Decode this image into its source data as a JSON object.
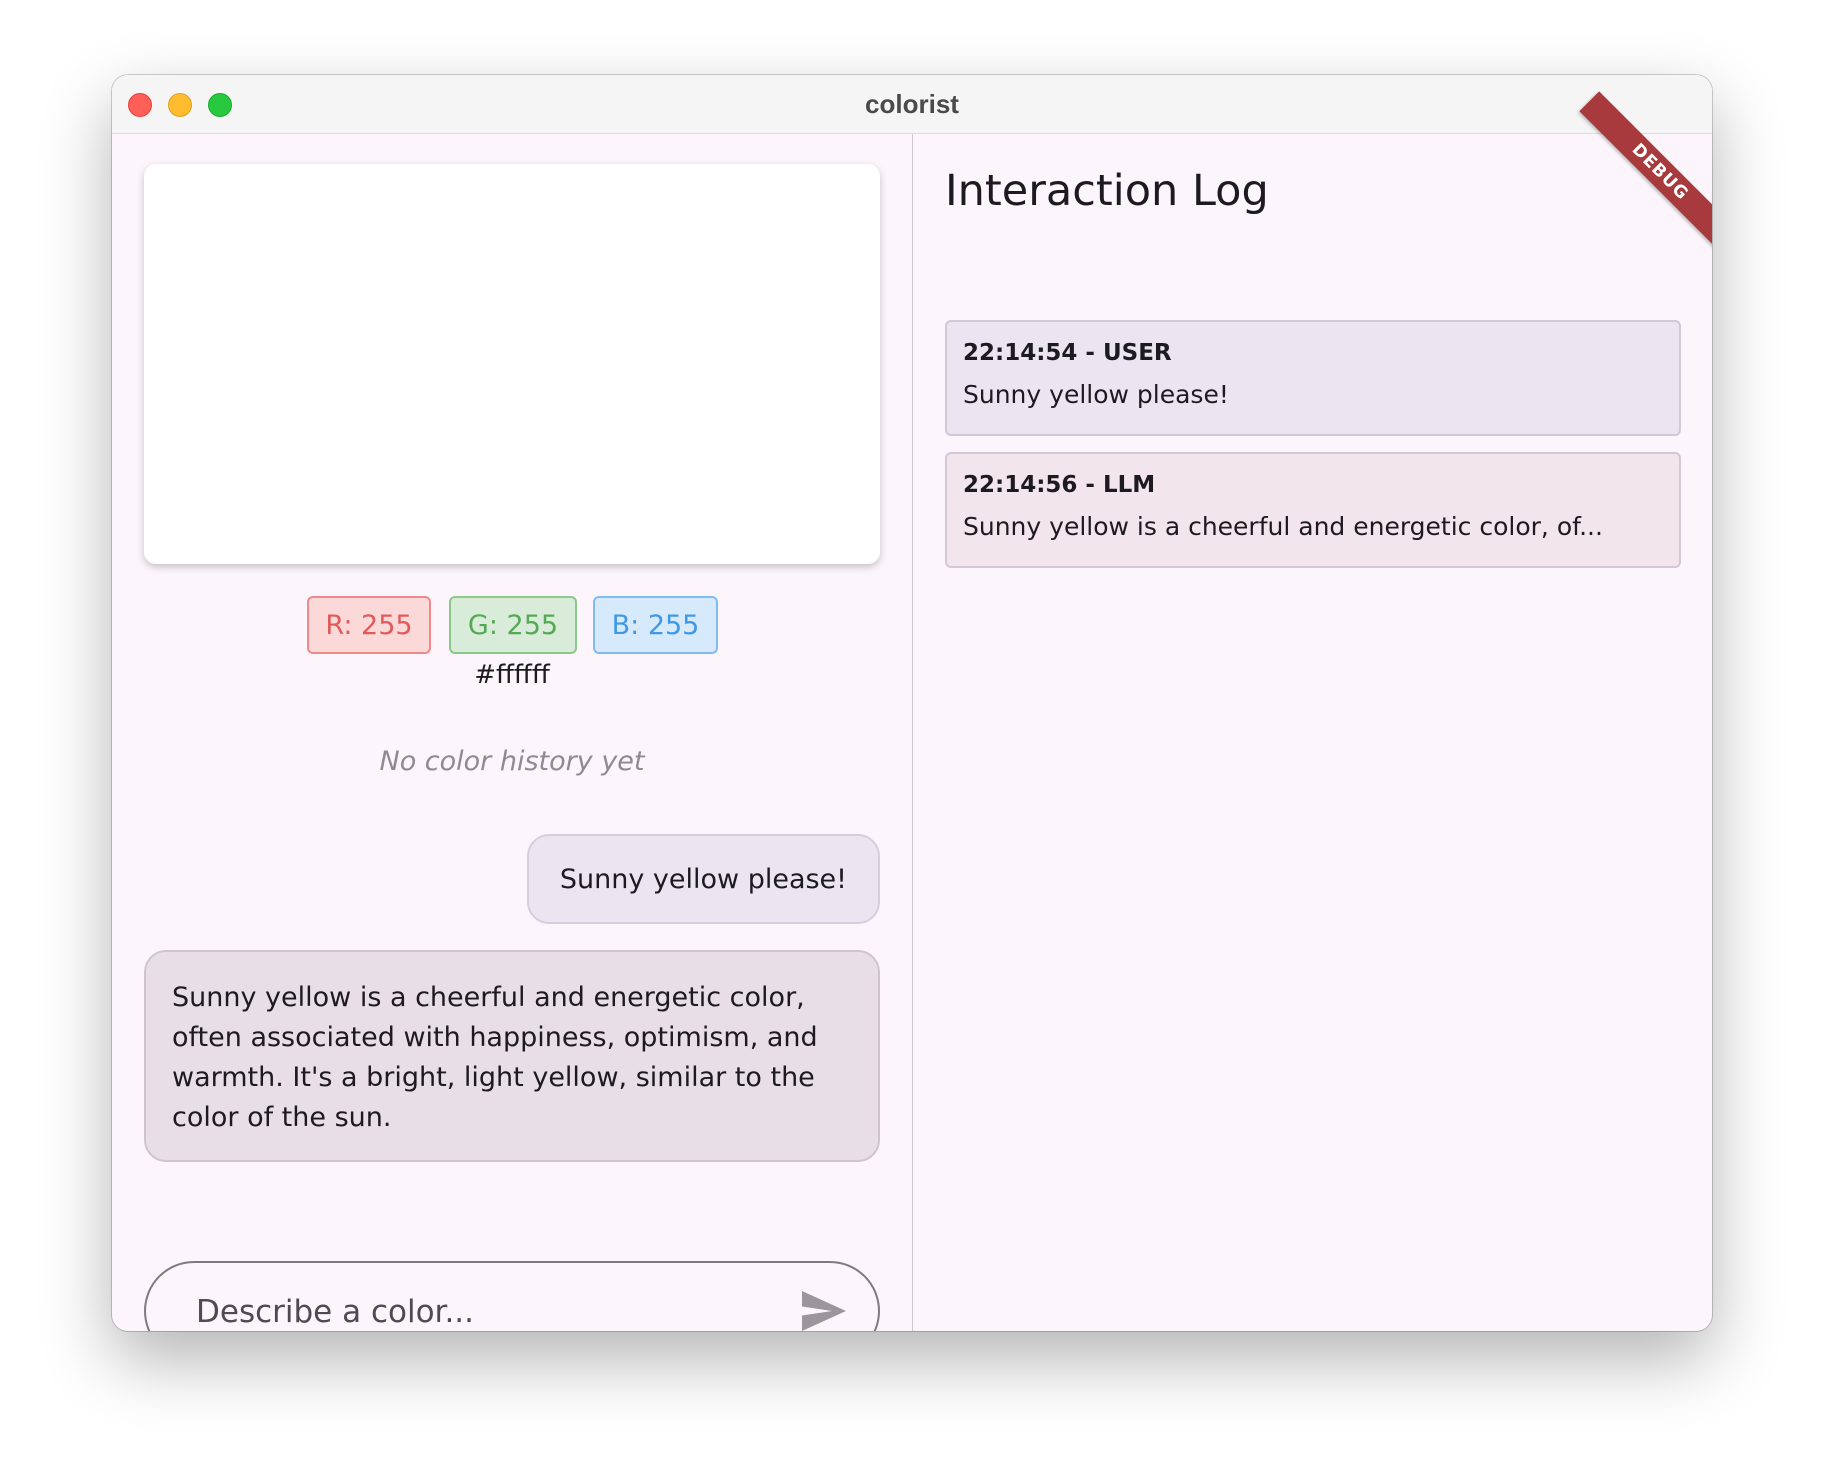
{
  "window": {
    "title": "colorist"
  },
  "color": {
    "r_label": "R: 255",
    "g_label": "G: 255",
    "b_label": "B: 255",
    "hex": "#ffffff",
    "swatch_hex": "#ffffff"
  },
  "history": {
    "empty_text": "No color history yet"
  },
  "chat": {
    "messages": [
      {
        "role": "user",
        "text": "Sunny yellow please!"
      },
      {
        "role": "llm",
        "text": "Sunny yellow is a cheerful and energetic color, often associated with happiness, optimism, and warmth. It's a bright, light yellow, similar to the color of the sun."
      }
    ],
    "input": {
      "placeholder": "Describe a color...",
      "value": ""
    },
    "send_icon": "send-icon"
  },
  "log": {
    "title": "Interaction Log",
    "entries": [
      {
        "header": "22:14:54 - USER",
        "text": "Sunny yellow please!"
      },
      {
        "header": "22:14:56 - LLM",
        "text": "Sunny yellow is a cheerful and energetic color, of..."
      }
    ]
  },
  "debug_banner": "DEBUG",
  "colors": {
    "background": "#fdf5fc",
    "red_chip": "#fcd9d9",
    "green_chip": "#d9ecd9",
    "blue_chip": "#d6eafc",
    "debug_ribbon": "#a8393c"
  }
}
